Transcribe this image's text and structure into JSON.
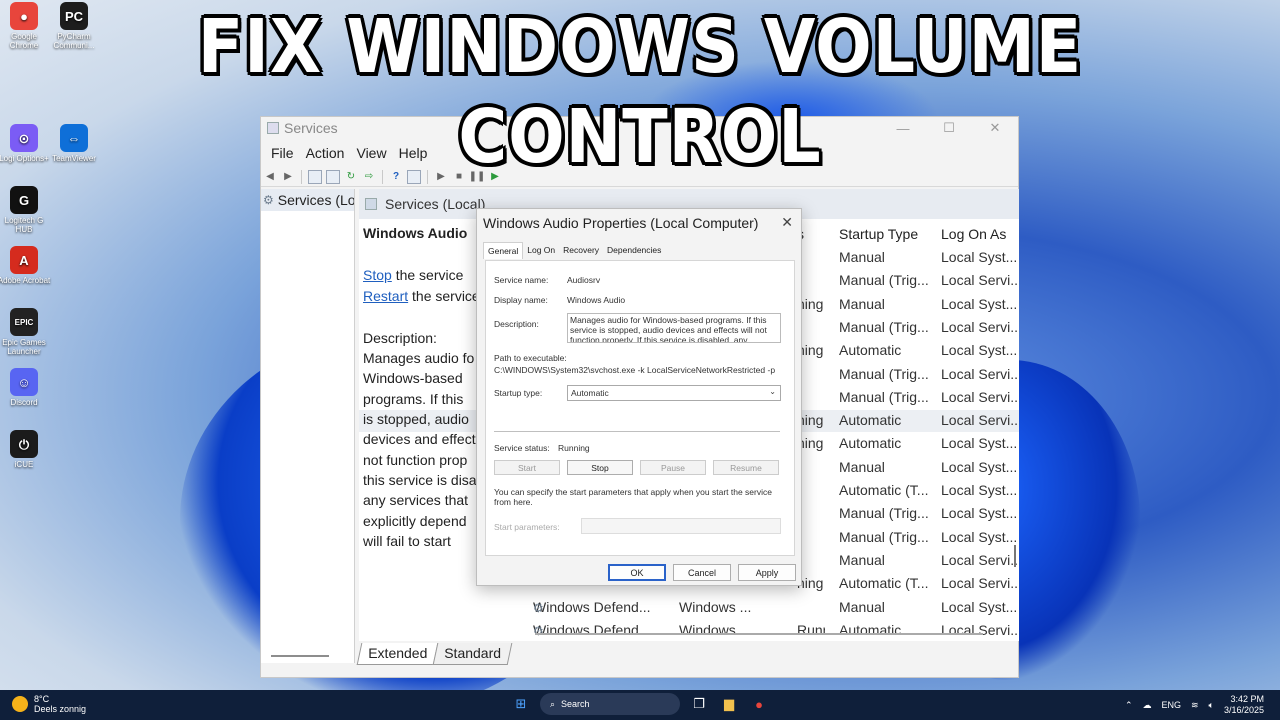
{
  "banner": "FIX WINDOWS VOLUME CONTROL",
  "desktop_icons": [
    {
      "label": "Google Chrome",
      "glyph": "●",
      "color": "#e8453c"
    },
    {
      "label": "PyCharm Communi...",
      "glyph": "PC",
      "color": "#1d1d1d"
    },
    {
      "label": "Logi Options+",
      "glyph": "⊙",
      "color": "#7b5cf5"
    },
    {
      "label": "TeamViewer",
      "glyph": "⇔",
      "color": "#0e6fd8"
    },
    {
      "label": "Logitech G HUB",
      "glyph": "G",
      "color": "#111111"
    },
    {
      "label": "Adobe Acrobat",
      "glyph": "A",
      "color": "#d52b1e"
    },
    {
      "label": "Epic Games Launcher",
      "glyph": "EPIC",
      "color": "#222222"
    },
    {
      "label": "Discord",
      "glyph": "☺",
      "color": "#5865f2"
    },
    {
      "label": "iCUE",
      "glyph": "⏻",
      "color": "#1b1b1b"
    }
  ],
  "services_window": {
    "title": "Services",
    "menu": [
      "File",
      "Action",
      "View",
      "Help"
    ],
    "left_node": "Services (Lo",
    "right_header": "Services (Local)",
    "detail": {
      "heading": "Windows Audio",
      "stop_link": "Stop",
      "stop_suffix": " the service",
      "restart_link": "Restart",
      "restart_suffix": " the service",
      "description_label": "Description:",
      "description_lines": [
        "Manages audio fo",
        "Windows-based",
        "programs.  If this",
        "is stopped, audio",
        "devices and effect",
        "not function prop",
        "this service is disa",
        "any services that",
        "explicitly depend",
        "will fail to start"
      ]
    },
    "columns": {
      "status_tail": "s",
      "startup_type": "Startup Type",
      "log_on_as": "Log On As"
    },
    "rows": [
      {
        "status": "",
        "startup": "Manual",
        "logon": "Local Syst..."
      },
      {
        "status": "",
        "startup": "Manual (Trig...",
        "logon": "Local Servi..."
      },
      {
        "status": "ning",
        "startup": "Manual",
        "logon": "Local Syst..."
      },
      {
        "status": "",
        "startup": "Manual (Trig...",
        "logon": "Local Servi..."
      },
      {
        "status": "ning",
        "startup": "Automatic",
        "logon": "Local Syst..."
      },
      {
        "status": "",
        "startup": "Manual (Trig...",
        "logon": "Local Servi..."
      },
      {
        "status": "",
        "startup": "Manual (Trig...",
        "logon": "Local Servi..."
      },
      {
        "status": "ning",
        "startup": "Automatic",
        "logon": "Local Servi..."
      },
      {
        "status": "ning",
        "startup": "Automatic",
        "logon": "Local Syst..."
      },
      {
        "status": "",
        "startup": "Manual",
        "logon": "Local Syst..."
      },
      {
        "status": "",
        "startup": "Automatic (T...",
        "logon": "Local Syst..."
      },
      {
        "status": "",
        "startup": "Manual (Trig...",
        "logon": "Local Syst..."
      },
      {
        "status": "",
        "startup": "Manual (Trig...",
        "logon": "Local Syst..."
      },
      {
        "status": "",
        "startup": "Manual",
        "logon": "Local Servi..."
      },
      {
        "status": "ning",
        "startup": "Automatic (T...",
        "logon": "Local Servi..."
      },
      {
        "name": "Windows Defend...",
        "desc": "Windows ...",
        "status": "",
        "startup": "Manual",
        "logon": "Local Syst..."
      },
      {
        "name": "Windows Defend...",
        "desc": "Windows ...",
        "status": "Running",
        "startup": "Automatic",
        "logon": "Local Servi..."
      }
    ],
    "tabs": [
      "Extended",
      "Standard"
    ]
  },
  "dialog": {
    "title": "Windows Audio Properties (Local Computer)",
    "tabs": [
      "General",
      "Log On",
      "Recovery",
      "Dependencies"
    ],
    "service_name_label": "Service name:",
    "service_name": "Audiosrv",
    "display_name_label": "Display name:",
    "display_name": "Windows Audio",
    "description_label": "Description:",
    "description": "Manages audio for Windows-based programs.  If this service is stopped, audio devices and effects will not function properly.  If this service is disabled, any",
    "path_label": "Path to executable:",
    "path": "C:\\WINDOWS\\System32\\svchost.exe -k LocalServiceNetworkRestricted -p",
    "startup_type_label": "Startup type:",
    "startup_type": "Automatic",
    "status_label": "Service status:",
    "status": "Running",
    "buttons": {
      "start": "Start",
      "stop": "Stop",
      "pause": "Pause",
      "resume": "Resume"
    },
    "hint": "You can specify the start parameters that apply when you start the service from here.",
    "params_label": "Start parameters:",
    "ok": "OK",
    "cancel": "Cancel",
    "apply": "Apply"
  },
  "taskbar": {
    "temp": "8°C",
    "weather": "Deels zonnig",
    "search": "Search",
    "lang": "ENG",
    "time": "3:42 PM",
    "date": "3/16/2025"
  }
}
